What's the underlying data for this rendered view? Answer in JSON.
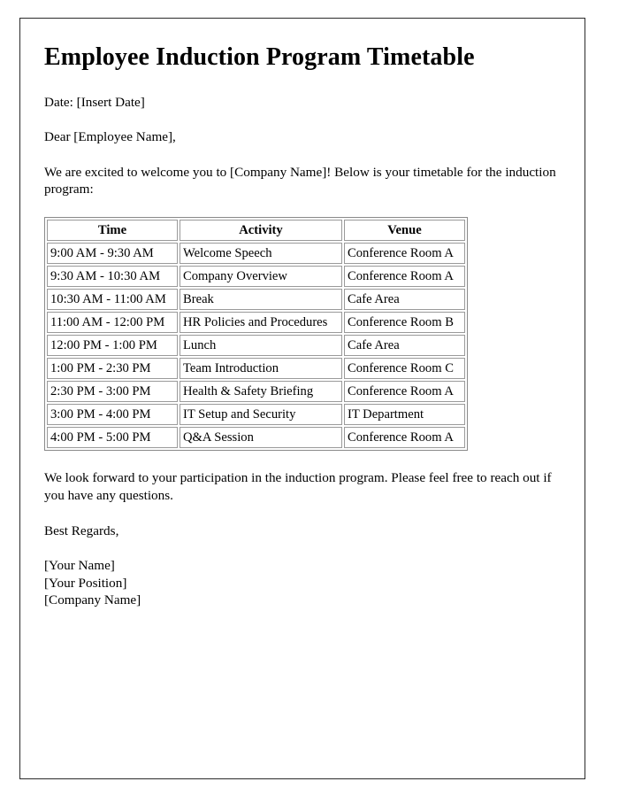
{
  "document": {
    "title": "Employee Induction Program Timetable",
    "date_line": "Date: [Insert Date]",
    "salutation": "Dear [Employee Name],",
    "intro_paragraph": "We are excited to welcome you to [Company Name]! Below is your timetable for the induction program:",
    "closing_paragraph": "We look forward to your participation in the induction program. Please feel free to reach out if you have any questions.",
    "sign_off": "Best Regards,",
    "signature": {
      "name": "[Your Name]",
      "position": "[Your Position]",
      "company": "[Company Name]"
    }
  },
  "timetable": {
    "columns": [
      "Time",
      "Activity",
      "Venue"
    ],
    "rows": [
      {
        "time": "9:00 AM - 9:30 AM",
        "activity": "Welcome Speech",
        "venue": "Conference Room A"
      },
      {
        "time": "9:30 AM - 10:30 AM",
        "activity": "Company Overview",
        "venue": "Conference Room A"
      },
      {
        "time": "10:30 AM - 11:00 AM",
        "activity": "Break",
        "venue": "Cafe Area"
      },
      {
        "time": "11:00 AM - 12:00 PM",
        "activity": "HR Policies and Procedures",
        "venue": "Conference Room B"
      },
      {
        "time": "12:00 PM - 1:00 PM",
        "activity": "Lunch",
        "venue": "Cafe Area"
      },
      {
        "time": "1:00 PM - 2:30 PM",
        "activity": "Team Introduction",
        "venue": "Conference Room C"
      },
      {
        "time": "2:30 PM - 3:00 PM",
        "activity": "Health & Safety Briefing",
        "venue": "Conference Room A"
      },
      {
        "time": "3:00 PM - 4:00 PM",
        "activity": "IT Setup and Security",
        "venue": "IT Department"
      },
      {
        "time": "4:00 PM - 5:00 PM",
        "activity": "Q&A Session",
        "venue": "Conference Room A"
      }
    ]
  },
  "colors": {
    "page_border": "#2b2b2b",
    "table_border": "#9a9a9a",
    "text": "#000000",
    "background": "#ffffff"
  }
}
